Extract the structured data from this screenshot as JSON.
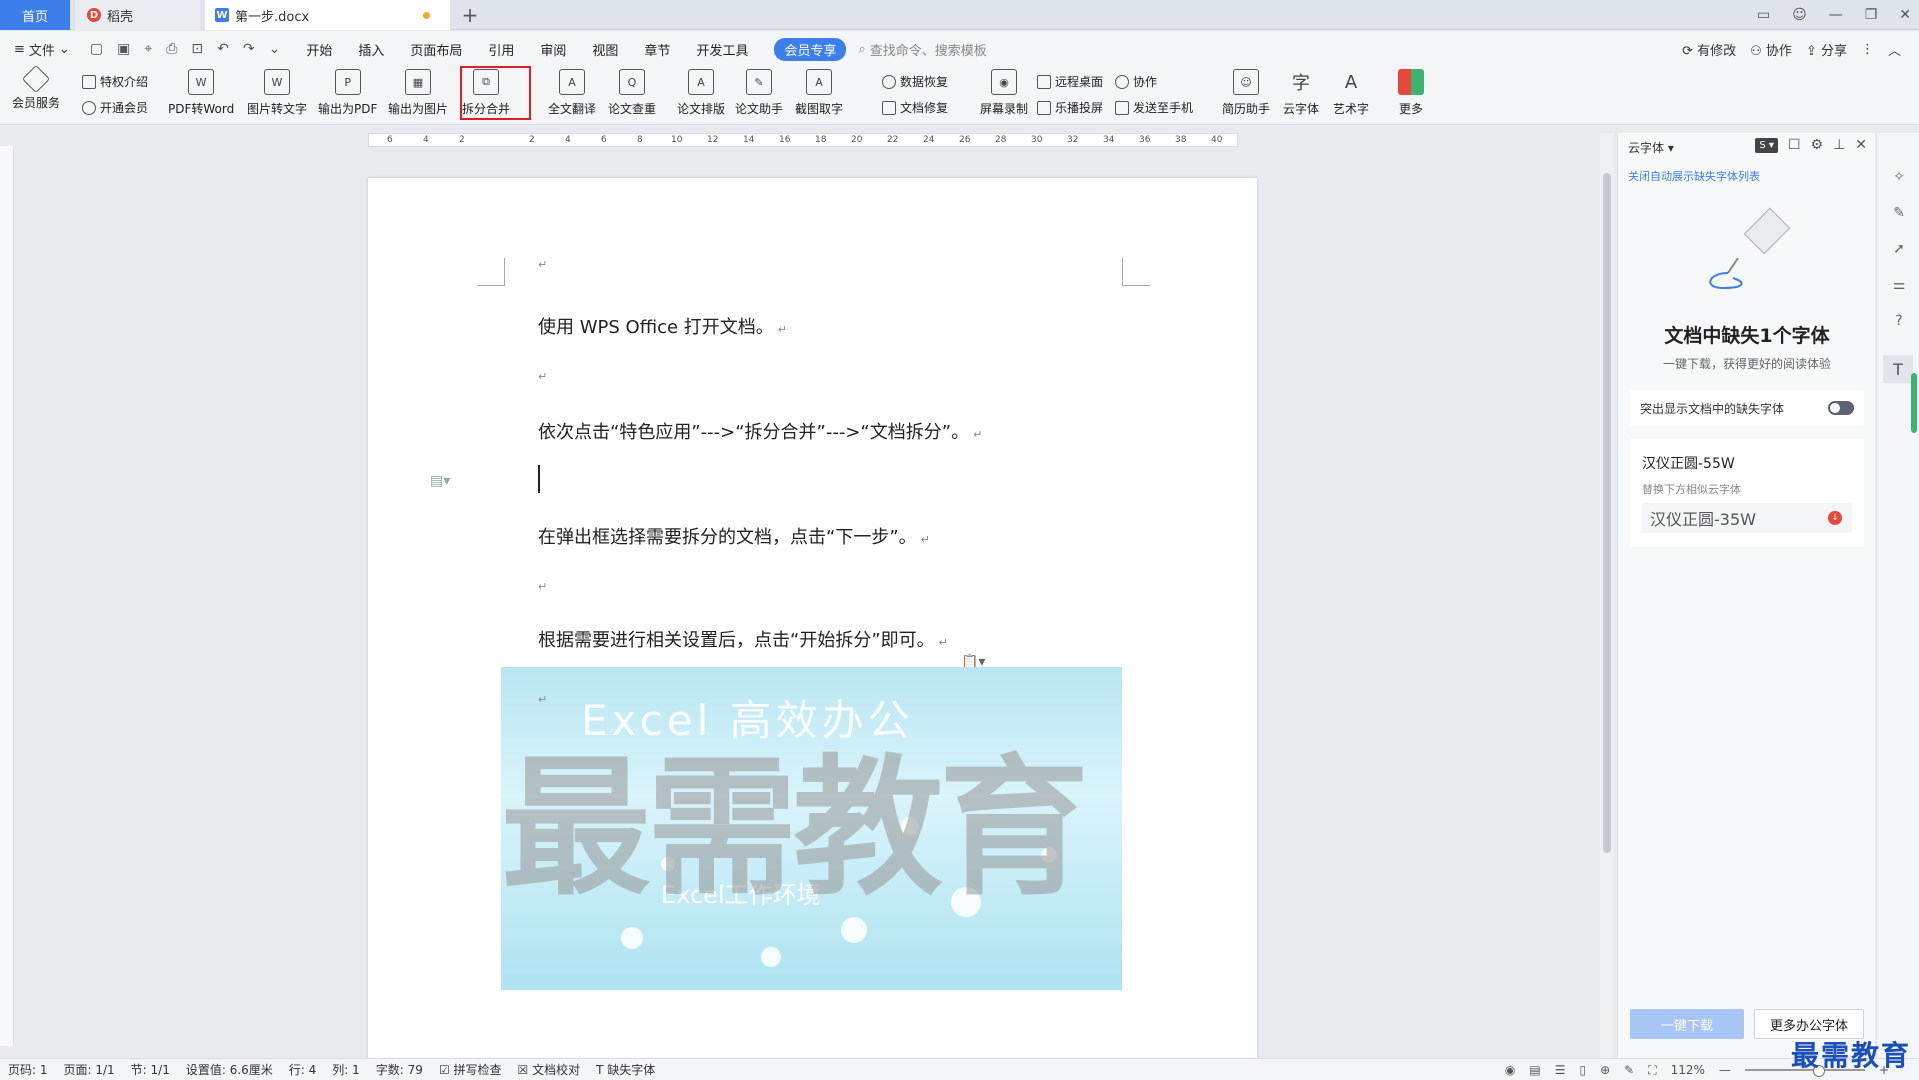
{
  "tabs": {
    "home": "首页",
    "daoke": "稻壳",
    "doc": "第一步.docx",
    "add": "+"
  },
  "menu": {
    "file": "文件",
    "items": [
      "开始",
      "插入",
      "页面布局",
      "引用",
      "审阅",
      "视图",
      "章节",
      "开发工具"
    ],
    "vip": "会员专享",
    "search_placeholder": "查找命令、搜索模板",
    "right": [
      "有修改",
      "协作",
      "分享"
    ]
  },
  "ribbon": {
    "member_service": "会员服务",
    "privilege_intro": "特权介绍",
    "open_member": "开通会员",
    "pdf_to_word": "PDF转Word",
    "img_to_text": "图片转文字",
    "export_pdf": "输出为PDF",
    "export_img": "输出为图片",
    "split_merge": "拆分合并",
    "full_translate": "全文翻译",
    "paper_check": "论文查重",
    "paper_layout": "论文排版",
    "paper_helper": "论文助手",
    "screenshot_ocr": "截图取字",
    "data_recovery": "数据恢复",
    "doc_repair": "文档修复",
    "screen_record": "屏幕录制",
    "remote_desktop": "远程桌面",
    "cast": "乐播投屏",
    "collab": "协作",
    "send_phone": "发送至手机",
    "resume": "简历助手",
    "cloud_font": "云字体",
    "art_text": "艺术字",
    "more": "更多"
  },
  "ruler_ticks": [
    "6",
    "4",
    "2",
    "2",
    "4",
    "6",
    "8",
    "10",
    "12",
    "14",
    "16",
    "18",
    "20",
    "22",
    "24",
    "26",
    "28",
    "30",
    "32",
    "34",
    "36",
    "38",
    "40"
  ],
  "document": {
    "p1": "使用 WPS Office 打开文档。",
    "p2": "依次点击“特色应用”--->“拆分合并”--->“文档拆分”。",
    "p3": "在弹出框选择需要拆分的文档，点击“下一步”。",
    "p4": "根据需要进行相关设置后，点击“开始拆分”即可。",
    "return_mark": "↵",
    "banner_title": "Excel 高效办公",
    "banner_sub": "Excel工作环境",
    "watermark": "最需教育"
  },
  "panel": {
    "header": "云字体",
    "link": "关闭自动展示缺失字体列表",
    "title": "文档中缺失1个字体",
    "subtitle": "一键下载，获得更好的阅读体验",
    "toggle_label": "突出显示文档中的缺失字体",
    "missing_font": "汉仪正圆-55W",
    "replace_hint": "替换下方相似云字体",
    "replacement_font": "汉仪正圆-35W",
    "btn_download": "一键下载",
    "btn_more": "更多办公字体"
  },
  "status": {
    "page_code": "页码: 1",
    "page": "页面: 1/1",
    "section": "节: 1/1",
    "setting": "设置值: 6.6厘米",
    "row": "行: 4",
    "col": "列: 1",
    "word_count": "字数: 79",
    "spell": "拼写检查",
    "proof": "文档校对",
    "missing_font": "缺失字体",
    "zoom": "112%"
  },
  "brand": "最需教育"
}
